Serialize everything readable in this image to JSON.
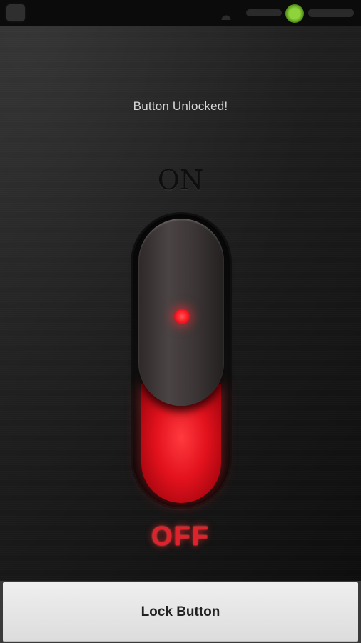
{
  "status_bar": {
    "app_icon": "app-icon",
    "wifi_icon": "wifi-icon",
    "battery_icon": "battery-icon"
  },
  "screen": {
    "message": "Button Unlocked!",
    "on_label": "ON",
    "off_label": "OFF",
    "switch_state": "off",
    "indicator_color": "#ff1f28"
  },
  "footer": {
    "lock_button_label": "Lock Button"
  }
}
